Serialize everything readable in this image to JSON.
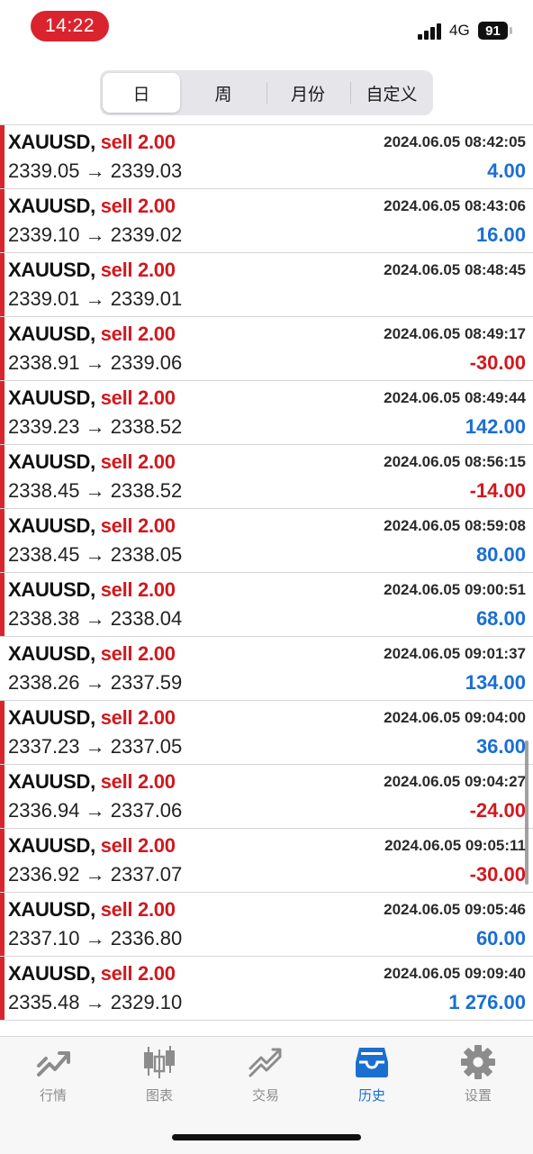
{
  "status_bar": {
    "time": "14:22",
    "network": "4G",
    "battery": "91"
  },
  "period_tabs": [
    {
      "label": "日",
      "active": true
    },
    {
      "label": "周",
      "active": false
    },
    {
      "label": "月份",
      "active": false
    },
    {
      "label": "自定义",
      "active": false
    }
  ],
  "trades": [
    {
      "symbol": "XAUUSD,",
      "side": "sell 2.00",
      "prices": "2339.05 → 2339.03",
      "datetime": "2024.06.05 08:42:05",
      "profit": "4.00",
      "profit_sign": "pos",
      "marker": true
    },
    {
      "symbol": "XAUUSD,",
      "side": "sell 2.00",
      "prices": "2339.10 → 2339.02",
      "datetime": "2024.06.05 08:43:06",
      "profit": "16.00",
      "profit_sign": "pos",
      "marker": true
    },
    {
      "symbol": "XAUUSD,",
      "side": "sell 2.00",
      "prices": "2339.01 → 2339.01",
      "datetime": "2024.06.05 08:48:45",
      "profit": "",
      "profit_sign": "pos",
      "marker": true
    },
    {
      "symbol": "XAUUSD,",
      "side": "sell 2.00",
      "prices": "2338.91 → 2339.06",
      "datetime": "2024.06.05 08:49:17",
      "profit": "-30.00",
      "profit_sign": "neg",
      "marker": true
    },
    {
      "symbol": "XAUUSD,",
      "side": "sell 2.00",
      "prices": "2339.23 → 2338.52",
      "datetime": "2024.06.05 08:49:44",
      "profit": "142.00",
      "profit_sign": "pos",
      "marker": true
    },
    {
      "symbol": "XAUUSD,",
      "side": "sell 2.00",
      "prices": "2338.45 → 2338.52",
      "datetime": "2024.06.05 08:56:15",
      "profit": "-14.00",
      "profit_sign": "neg",
      "marker": true
    },
    {
      "symbol": "XAUUSD,",
      "side": "sell 2.00",
      "prices": "2338.45 → 2338.05",
      "datetime": "2024.06.05 08:59:08",
      "profit": "80.00",
      "profit_sign": "pos",
      "marker": true
    },
    {
      "symbol": "XAUUSD,",
      "side": "sell 2.00",
      "prices": "2338.38 → 2338.04",
      "datetime": "2024.06.05 09:00:51",
      "profit": "68.00",
      "profit_sign": "pos",
      "marker": true
    },
    {
      "symbol": "XAUUSD,",
      "side": "sell 2.00",
      "prices": "2338.26 → 2337.59",
      "datetime": "2024.06.05 09:01:37",
      "profit": "134.00",
      "profit_sign": "pos",
      "marker": false
    },
    {
      "symbol": "XAUUSD,",
      "side": "sell 2.00",
      "prices": "2337.23 → 2337.05",
      "datetime": "2024.06.05 09:04:00",
      "profit": "36.00",
      "profit_sign": "pos",
      "marker": true
    },
    {
      "symbol": "XAUUSD,",
      "side": "sell 2.00",
      "prices": "2336.94 → 2337.06",
      "datetime": "2024.06.05 09:04:27",
      "profit": "-24.00",
      "profit_sign": "neg",
      "marker": true
    },
    {
      "symbol": "XAUUSD,",
      "side": "sell 2.00",
      "prices": "2336.92 → 2337.07",
      "datetime": "2024.06.05 09:05:11",
      "profit": "-30.00",
      "profit_sign": "neg",
      "marker": true
    },
    {
      "symbol": "XAUUSD,",
      "side": "sell 2.00",
      "prices": "2337.10 → 2336.80",
      "datetime": "2024.06.05 09:05:46",
      "profit": "60.00",
      "profit_sign": "pos",
      "marker": true
    },
    {
      "symbol": "XAUUSD,",
      "side": "sell 2.00",
      "prices": "2335.48 → 2329.10",
      "datetime": "2024.06.05 09:09:40",
      "profit": "1 276.00",
      "profit_sign": "pos",
      "marker": true
    }
  ],
  "tab_bar": [
    {
      "label": "行情",
      "icon": "quotes-icon",
      "active": false
    },
    {
      "label": "图表",
      "icon": "candlestick-chart-icon",
      "active": false
    },
    {
      "label": "交易",
      "icon": "trade-trend-icon",
      "active": false
    },
    {
      "label": "历史",
      "icon": "history-inbox-icon",
      "active": true
    },
    {
      "label": "设置",
      "icon": "gear-icon",
      "active": false
    }
  ],
  "colors": {
    "sell": "#d0191f",
    "profit_positive": "#1a6fd1",
    "profit_negative": "#d0191f",
    "marker": "#d9242e",
    "tab_active": "#1a6fd1",
    "tab_inactive": "#8c8c8c"
  }
}
